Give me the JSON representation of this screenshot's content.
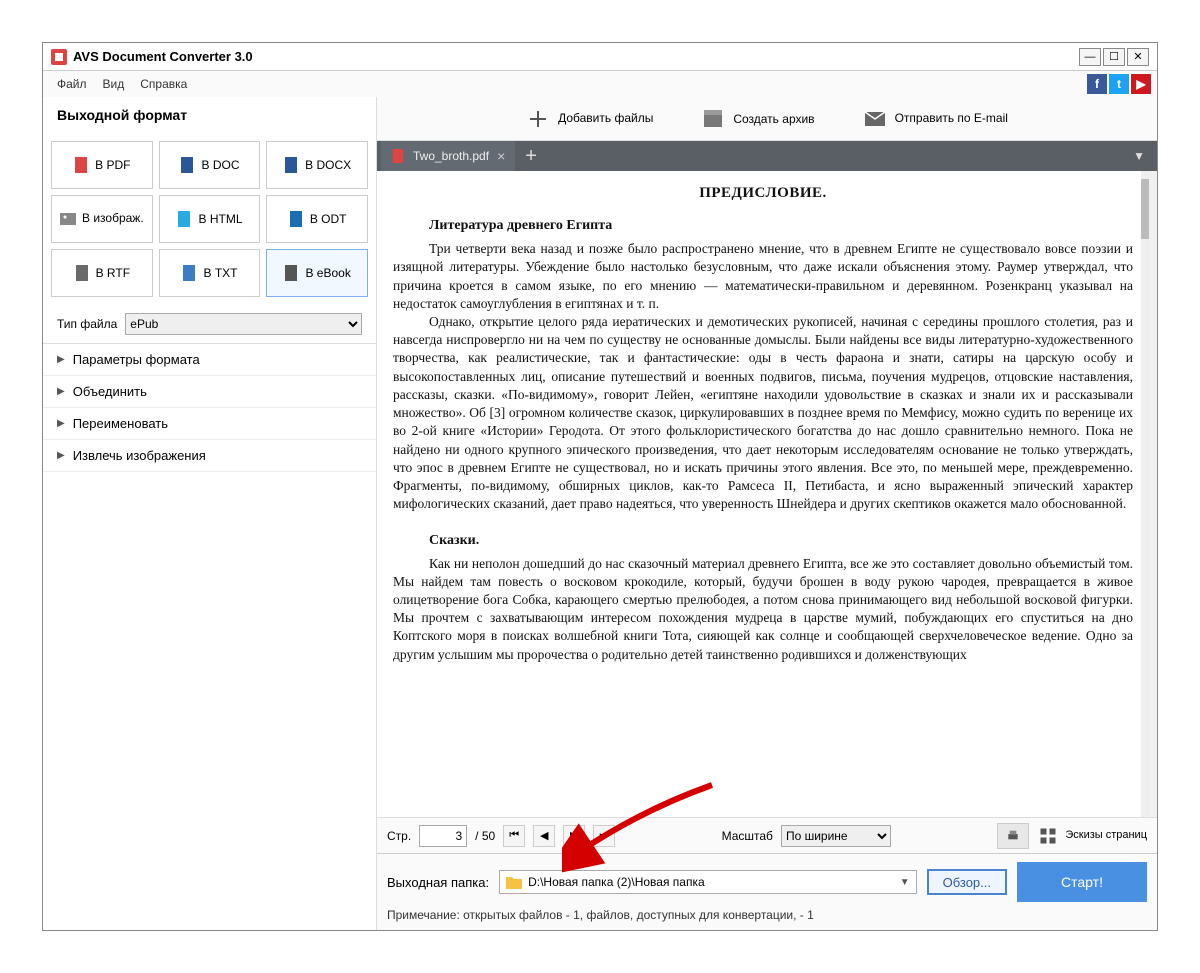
{
  "app": {
    "title": "AVS Document Converter 3.0"
  },
  "menu": {
    "file": "Файл",
    "view": "Вид",
    "help": "Справка"
  },
  "sidebar": {
    "header": "Выходной формат",
    "formats": [
      "В PDF",
      "В DOC",
      "В DOCX",
      "В изображ.",
      "В HTML",
      "В ODT",
      "В RTF",
      "В TXT",
      "В eBook"
    ],
    "filetype_label": "Тип файла",
    "filetype_value": "ePub",
    "acc": [
      "Параметры формата",
      "Объединить",
      "Переименовать",
      "Извлечь изображения"
    ]
  },
  "toolbar": {
    "add": "Добавить файлы",
    "archive": "Создать архив",
    "email": "Отправить по E-mail"
  },
  "tab": {
    "name": "Two_broth.pdf"
  },
  "doc": {
    "title": "ПРЕДИСЛОВИЕ.",
    "h1": "Литература древнего Египта",
    "p1": "Три четверти века назад и позже было распространено мнение, что в древнем Египте не существовало вовсе поэзии и изящной литературы. Убеждение было настолько безусловным, что даже искали объяснения этому. Раумер утверждал, что причина кроется в самом языке, по его мнению — математически-правильном и деревянном. Розенкранц указывал на недостаток самоуглубления в египтянах и т. п.",
    "p2": "Однако, открытие целого ряда иератических и демотических рукописей, начиная с середины прошлого столетия, раз и навсегда ниспровергло ни на чем по существу не основанные домыслы. Были найдены все виды литературно-художественного творчества, как реалистические, так и фантастические: оды в честь фараона и знати, сатиры на царскую особу и высокопоставленных лиц, описание путешествий и военных подвигов, письма, поучения мудрецов, отцовские наставления, рассказы, сказки. «По-видимому», говорит Лейен, «египтяне находили удовольствие в сказках и знали их и рассказывали множество». Об [3] огромном количестве сказок, циркулировавших в позднее время по Мемфису, можно судить по веренице их во 2-ой книге «Истории» Геродота. От этого фольклористического богатства до нас дошло сравнительно немного. Пока не найдено ни одного крупного эпического произведения, что дает некоторым исследователям основание не только утверждать, что эпос в древнем Египте не существовал, но и искать причины этого явления. Все это, по меньшей мере, преждевременно. Фрагменты, по-видимому, обширных циклов, как-то Рамсеса II, Петибаста, и ясно выраженный эпический характер мифологических сказаний, дает право надеяться, что уверенность Шнейдера и других скептиков окажется мало обоснованной.",
    "h2": "Сказки.",
    "p3": "Как ни неполон дошедший до нас сказочный материал древнего Египта, все же это составляет довольно объемистый том. Мы найдем там повесть о восковом крокодиле, который, будучи брошен в воду рукою чародея, превращается в живое олицетворение бога Собка, карающего смертью прелюбодея, а потом снова принимающего вид небольшой восковой фигурки. Мы прочтем с захватывающим интересом похождения мудреца в царстве мумий, побуждающих его спуститься на дно Коптского моря в поисках волшебной книги Тота, сияющей как солнце и сообщающей сверхчеловеческое ведение. Одно за другим услышим мы пророчества о родительно детей таинственно родившихся и долженствующих"
  },
  "preview": {
    "page_label": "Стр.",
    "page_current": "3",
    "page_total": "/ 50",
    "zoom_label": "Масштаб",
    "zoom_value": "По ширине",
    "thumbs": "Эскизы страниц"
  },
  "footer": {
    "out_label": "Выходная папка:",
    "path": "D:\\Новая папка (2)\\Новая папка",
    "browse": "Обзор...",
    "start": "Старт!",
    "note": "Примечание: открытых файлов - 1, файлов, доступных для конвертации, - 1"
  },
  "colors": {
    "fb": "#3b5998",
    "tw": "#1da1f2",
    "yt": "#cc181e"
  }
}
